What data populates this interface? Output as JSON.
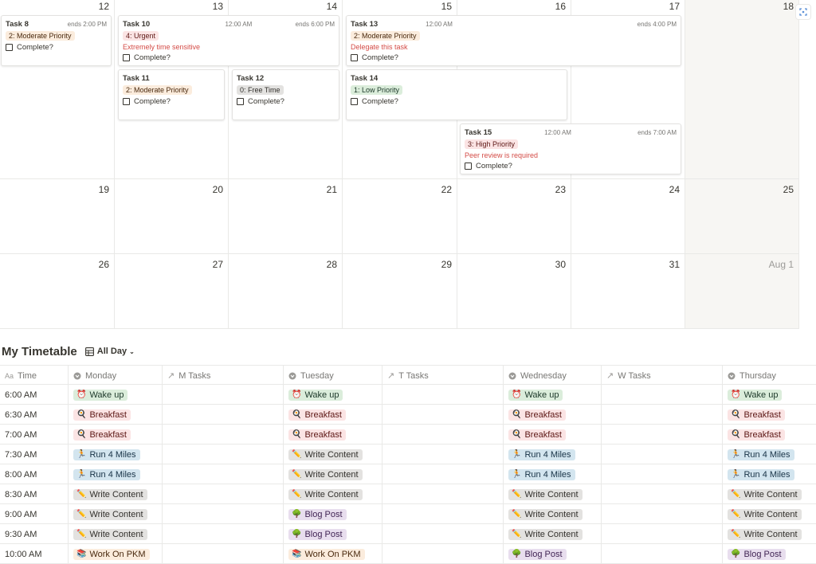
{
  "calendar": {
    "week1": {
      "days": [
        "12",
        "13",
        "14",
        "15",
        "16",
        "17",
        "18"
      ]
    },
    "week2": {
      "days": [
        "19",
        "20",
        "21",
        "22",
        "23",
        "24",
        "25"
      ]
    },
    "week3": {
      "days": [
        "26",
        "27",
        "28",
        "29",
        "30",
        "31",
        "Aug 1"
      ]
    },
    "tasks": {
      "task8": {
        "title": "Task 8",
        "ends": "ends 2:00 PM",
        "priority": "2: Moderate Priority",
        "complete": "Complete?"
      },
      "task10": {
        "title": "Task 10",
        "time": "12:00 AM",
        "ends": "ends 6:00 PM",
        "priority": "4: Urgent",
        "note": "Extremely time sensitive",
        "complete": "Complete?"
      },
      "task13": {
        "title": "Task 13",
        "time": "12:00 AM",
        "ends": "ends 4:00 PM",
        "priority": "2: Moderate Priority",
        "note": "Delegate this task",
        "complete": "Complete?"
      },
      "task11": {
        "title": "Task 11",
        "priority": "2: Moderate Priority",
        "complete": "Complete?"
      },
      "task12": {
        "title": "Task 12",
        "priority": "0: Free Time",
        "complete": "Complete?"
      },
      "task14": {
        "title": "Task 14",
        "priority": "1: Low Priority",
        "complete": "Complete?"
      },
      "task15": {
        "title": "Task 15",
        "time": "12:00 AM",
        "ends": "ends 7:00 AM",
        "priority": "3: High Priority",
        "note": "Peer review is required",
        "complete": "Complete?"
      }
    }
  },
  "timetable": {
    "title": "My Timetable",
    "view": "All Day",
    "columns": [
      "Time",
      "Monday",
      "M Tasks",
      "Tuesday",
      "T Tasks",
      "Wednesday",
      "W Tasks",
      "Thursday"
    ],
    "rows": [
      {
        "time": "6:00 AM",
        "mon": "Wake up",
        "tue": "Wake up",
        "wed": "Wake up",
        "thu": "Wake up"
      },
      {
        "time": "6:30 AM",
        "mon": "Breakfast",
        "tue": "Breakfast",
        "wed": "Breakfast",
        "thu": "Breakfast"
      },
      {
        "time": "7:00 AM",
        "mon": "Breakfast",
        "tue": "Breakfast",
        "wed": "Breakfast",
        "thu": "Breakfast"
      },
      {
        "time": "7:30 AM",
        "mon": "Run 4 Miles",
        "tue": "Write Content",
        "wed": "Run 4 Miles",
        "thu": "Run 4 Miles"
      },
      {
        "time": "8:00 AM",
        "mon": "Run 4 Miles",
        "tue": "Write Content",
        "wed": "Run 4 Miles",
        "thu": "Run 4 Miles"
      },
      {
        "time": "8:30 AM",
        "mon": "Write Content",
        "tue": "Write Content",
        "wed": "Write Content",
        "thu": "Write Content"
      },
      {
        "time": "9:00 AM",
        "mon": "Write Content",
        "tue": "Blog Post",
        "wed": "Write Content",
        "thu": "Write Content"
      },
      {
        "time": "9:30 AM",
        "mon": "Write Content",
        "tue": "Blog Post",
        "wed": "Write Content",
        "thu": "Write Content"
      },
      {
        "time": "10:00 AM",
        "mon": "Work On PKM",
        "tue": "Work On PKM",
        "wed": "Blog Post",
        "thu": "Blog Post"
      }
    ],
    "activity_icons": {
      "Wake up": "alarm-clock-icon",
      "Breakfast": "frying-pan-icon",
      "Run 4 Miles": "runner-icon",
      "Write Content": "pencil-icon",
      "Blog Post": "tree-icon",
      "Work On PKM": "books-icon"
    }
  }
}
